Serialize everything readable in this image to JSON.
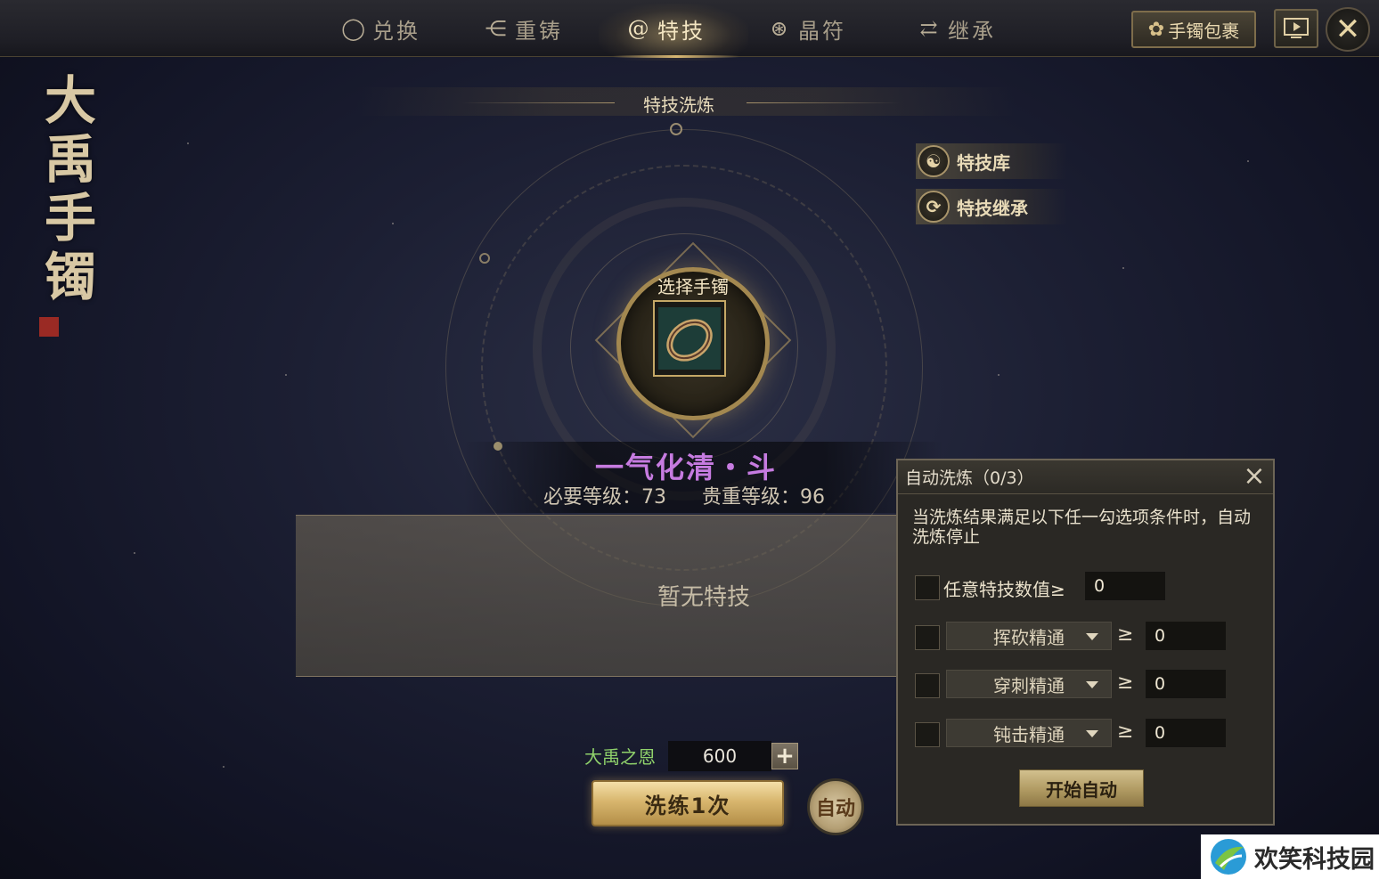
{
  "tabs": [
    {
      "label": "兑换",
      "icon": "ring-icon"
    },
    {
      "label": "重铸",
      "icon": "recast-icon"
    },
    {
      "label": "特技",
      "icon": "swirl-icon"
    },
    {
      "label": "晶符",
      "icon": "rune-icon"
    },
    {
      "label": "继承",
      "icon": "arrows-icon"
    }
  ],
  "active_tab": "特技",
  "header": {
    "bag_button": "手镯包裹",
    "video_icon": "video-icon",
    "close_icon": "close-icon"
  },
  "logo": {
    "line1": "大",
    "line2": "禹",
    "line3": "手",
    "line4": "镯"
  },
  "section_title": "特技洗炼",
  "side_buttons": {
    "library": "特技库",
    "inherit": "特技继承"
  },
  "slot": {
    "label": "选择手镯",
    "item": "bracelet-icon"
  },
  "skill": {
    "name": "一气化清・斗",
    "required_level": "必要等级：73",
    "rarity_level": "贵重等级：96",
    "empty_text": "暂无特技"
  },
  "currency": {
    "label": "大禹之恩",
    "value": "600",
    "plus": "+"
  },
  "actions": {
    "refine_once": "洗练1次",
    "auto": "自动"
  },
  "dialog": {
    "title": "自动洗炼（0/3）",
    "description": "当洗炼结果满足以下任一勾选项条件时，自动洗炼停止",
    "any_label": "任意特技数值≥",
    "any_value": "0",
    "conditions": [
      {
        "option": "挥砍精通",
        "op": "≥",
        "value": "0"
      },
      {
        "option": "穿刺精通",
        "op": "≥",
        "value": "0"
      },
      {
        "option": "钝击精通",
        "op": "≥",
        "value": "0"
      }
    ],
    "start_button": "开始自动"
  },
  "watermark": "欢笑科技园",
  "colors": {
    "skill_name": "#c67be0",
    "currency_label": "#8fd16b",
    "gold": "#d8b66e"
  }
}
